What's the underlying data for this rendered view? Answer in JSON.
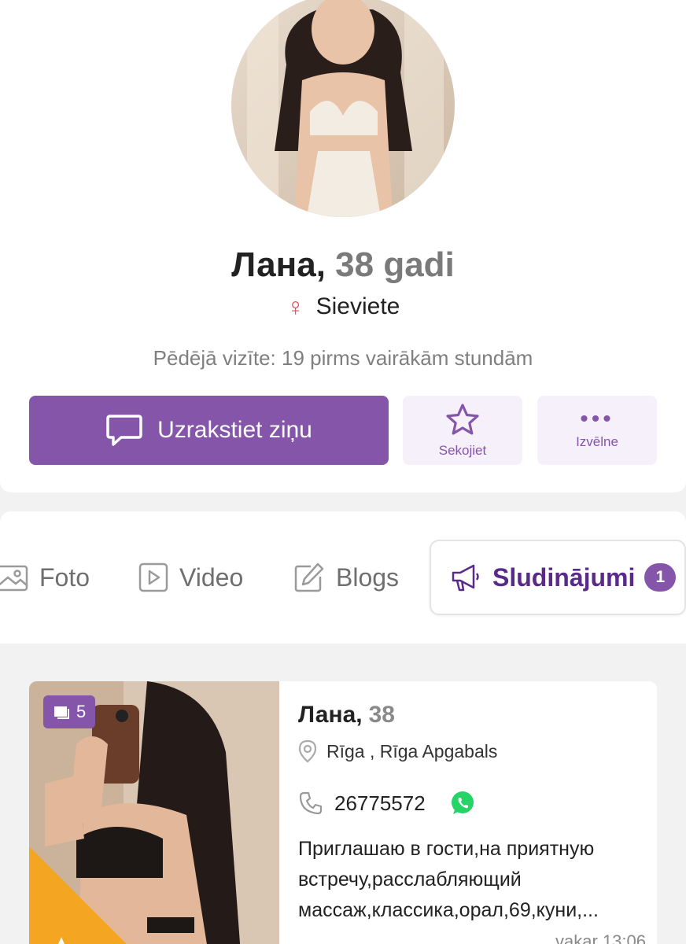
{
  "profile": {
    "name": "Лана,",
    "age": "38 gadi",
    "gender": "Sieviete",
    "last_visit": "Pēdējā vizīte: 19 pirms vairākām stundām"
  },
  "actions": {
    "message_label": "Uzrakstiet ziņu",
    "follow_label": "Sekojiet",
    "menu_dots": "•••",
    "menu_label": "Izvēlne"
  },
  "tabs": [
    {
      "label": "Foto",
      "icon": "image-icon"
    },
    {
      "label": "Video",
      "icon": "video-icon"
    },
    {
      "label": "Blogs",
      "icon": "edit-icon"
    },
    {
      "label": "Sludinājumi",
      "icon": "megaphone-icon",
      "count": "1",
      "active": true
    }
  ],
  "ad": {
    "photo_count": "5",
    "name": "Лана,",
    "age": "38",
    "location": "Rīga ,  Rīga Apgabals",
    "phone": "26775572",
    "description": "Приглашаю в гости,на приятную встречу,расслабляющий массаж,классика,орал,69,куни,...",
    "time": "vakar 13:06"
  },
  "colors": {
    "accent": "#8455a8",
    "accent_light": "#f6f0fb",
    "vip": "#f4a623",
    "female": "#e04b5a",
    "whatsapp": "#25d366"
  }
}
